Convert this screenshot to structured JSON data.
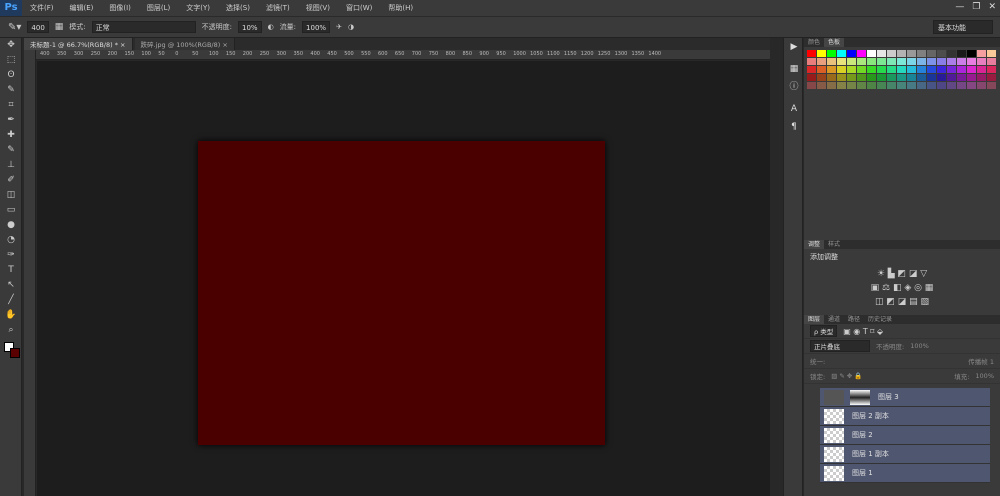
{
  "app": {
    "logo": "Ps"
  },
  "menu": [
    "文件(F)",
    "编辑(E)",
    "图像(I)",
    "图层(L)",
    "文字(Y)",
    "选择(S)",
    "滤镜(T)",
    "视图(V)",
    "窗口(W)",
    "帮助(H)"
  ],
  "window_controls": [
    "—",
    "❐",
    "✕"
  ],
  "options": {
    "brush_size": "400",
    "mode_label": "模式:",
    "mode_value": "正常",
    "opacity_label": "不透明度:",
    "opacity_value": "10%",
    "flow_label": "流量:",
    "flow_value": "100%"
  },
  "workspace": "基本功能",
  "tabs": [
    {
      "label": "未标题-1 @ 66.7%(RGB/8) * ×",
      "active": true
    },
    {
      "label": "跌碎.jpg @ 100%(RGB/8) ×",
      "active": false
    }
  ],
  "ruler": [
    "400",
    "350",
    "300",
    "250",
    "200",
    "150",
    "100",
    "50",
    "0",
    "50",
    "100",
    "150",
    "200",
    "250",
    "300",
    "350",
    "400",
    "450",
    "500",
    "550",
    "600",
    "650",
    "700",
    "750",
    "800",
    "850",
    "900",
    "950",
    "1000",
    "1050",
    "1100",
    "1150",
    "1200",
    "1250",
    "1300",
    "1350",
    "1400"
  ],
  "document": {
    "fill_color": "#4b0000"
  },
  "swatch_panel": {
    "tabs": [
      "颜色",
      "色板"
    ],
    "active": 1
  },
  "adjust_panel": {
    "tabs": [
      "调整",
      "样式"
    ],
    "heading": "添加调整"
  },
  "layers_panel": {
    "tabs": [
      "图层",
      "通道",
      "路径",
      "历史记录"
    ],
    "filter": "ρ 类型",
    "blend": "正片叠底",
    "opacity_label": "不透明度:",
    "opacity": "100%",
    "unify": "统一:",
    "propagate": "传播帧 1",
    "lock": "锁定:",
    "fill_label": "填充:",
    "fill": "100%",
    "layers": [
      {
        "name": "图层 3",
        "mask": true
      },
      {
        "name": "图层 2 副本"
      },
      {
        "name": "图层 2"
      },
      {
        "name": "图层 1 副本"
      },
      {
        "name": "图层 1"
      }
    ]
  },
  "colors": {
    "accent": "#4aa3ff",
    "layer_selected": "#4f5670"
  }
}
